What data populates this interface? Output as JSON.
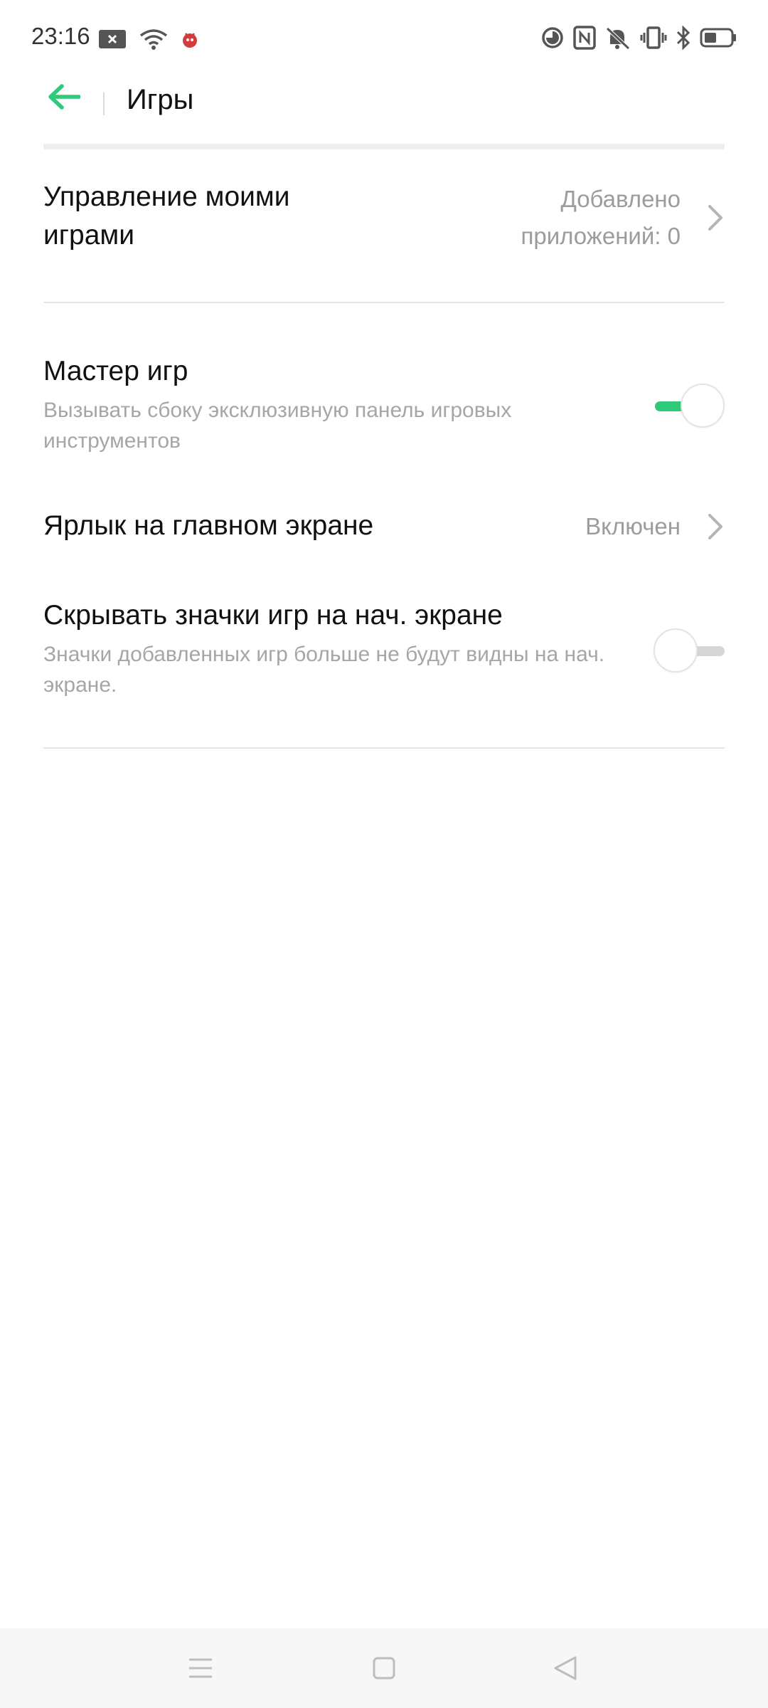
{
  "status_bar": {
    "time": "23:16",
    "left_icons": [
      "close-notification-icon",
      "wifi-icon",
      "bug-icon"
    ],
    "right_icons": [
      "timer-icon",
      "nfc-icon",
      "mute-icon",
      "vibrate-icon",
      "bluetooth-icon",
      "battery-icon"
    ]
  },
  "app_bar": {
    "title": "Игры",
    "accent_color": "#2fc97a"
  },
  "settings": {
    "manage_games": {
      "title": "Управление моими играми",
      "value": "Добавлено приложений: 0"
    },
    "game_master": {
      "title": "Мастер игр",
      "subtitle": "Вызывать сбоку эксклюзивную панель игровых инструментов",
      "enabled": true
    },
    "home_shortcut": {
      "title": "Ярлык на главном экране",
      "value": "Включен"
    },
    "hide_icons": {
      "title": "Скрывать значки игр на нач. экране",
      "subtitle": "Значки добавленных игр больше не будут видны на нач. экране.",
      "enabled": false
    }
  },
  "nav_bar": {
    "buttons": [
      "menu-icon",
      "home-icon",
      "back-triangle-icon"
    ]
  }
}
